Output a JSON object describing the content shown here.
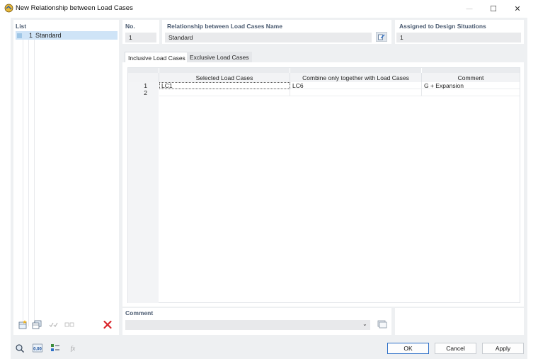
{
  "window": {
    "title": "New Relationship between Load Cases",
    "minimize": "—",
    "maximize": "☐",
    "close": "✕"
  },
  "list": {
    "label": "List",
    "items": [
      {
        "number": "1",
        "name": "Standard"
      }
    ]
  },
  "header": {
    "no_label": "No.",
    "no_value": "1",
    "name_label": "Relationship between Load Cases Name",
    "name_value": "Standard",
    "assigned_label": "Assigned to Design Situations",
    "assigned_value": "1"
  },
  "tabs": [
    {
      "label": "Inclusive Load Cases",
      "active": true
    },
    {
      "label": "Exclusive Load Cases",
      "active": false
    }
  ],
  "table": {
    "columns": [
      "Selected Load Cases",
      "Combine only together with Load Cases",
      "Comment"
    ],
    "rows": [
      {
        "num": "1",
        "selected": "LC1",
        "combine": "LC6",
        "comment": "G + Expansion"
      },
      {
        "num": "2",
        "selected": "",
        "combine": "",
        "comment": ""
      }
    ]
  },
  "comment": {
    "label": "Comment",
    "value": "",
    "dropdown_arrow": "⌄"
  },
  "buttons": {
    "ok": "OK",
    "cancel": "Cancel",
    "apply": "Apply"
  },
  "icons": {
    "list_toolbar": [
      "new-item-icon",
      "copy-item-icon",
      "check-all-icon",
      "uncheck-all-icon",
      "delete-icon"
    ],
    "bottom_toolbar": [
      "search-icon",
      "units-icon",
      "list-settings-icon",
      "function-icon"
    ]
  },
  "colors": {
    "accent": "#2b6ec7",
    "selection": "#cfe4f7",
    "delete": "#d9262c",
    "section_label": "#4a5a70"
  }
}
